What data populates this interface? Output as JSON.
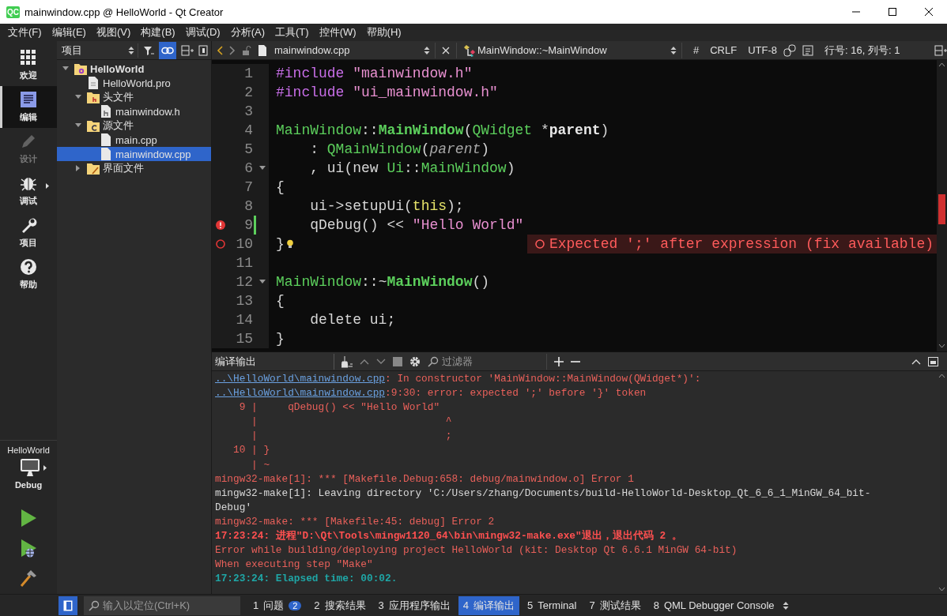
{
  "window": {
    "logo": "QC",
    "title": "mainwindow.cpp @ HelloWorld - Qt Creator"
  },
  "menu": [
    "文件(F)",
    "编辑(E)",
    "视图(V)",
    "构建(B)",
    "调试(D)",
    "分析(A)",
    "工具(T)",
    "控件(W)",
    "帮助(H)"
  ],
  "mode_bar": {
    "items": [
      {
        "kind": "welcome",
        "label": "欢迎",
        "selected": false,
        "disabled": false
      },
      {
        "kind": "edit",
        "label": "编辑",
        "selected": true,
        "disabled": false
      },
      {
        "kind": "design",
        "label": "设计",
        "selected": false,
        "disabled": true
      },
      {
        "kind": "debug",
        "label": "调试",
        "selected": false,
        "disabled": false
      },
      {
        "kind": "projects",
        "label": "项目",
        "selected": false,
        "disabled": false
      },
      {
        "kind": "help",
        "label": "帮助",
        "selected": false,
        "disabled": false
      }
    ],
    "kit": {
      "project": "HelloWorld",
      "config": "Debug"
    }
  },
  "project_panel": {
    "view": "项目",
    "tree": [
      {
        "kind": "project",
        "label": "HelloWorld",
        "expanded": true,
        "selected": false,
        "children": [
          {
            "kind": "pro-file",
            "label": "HelloWorld.pro",
            "selected": false
          },
          {
            "kind": "header-folder",
            "label": "头文件",
            "expanded": true,
            "selected": false,
            "children": [
              {
                "kind": "header-file",
                "label": "mainwindow.h",
                "selected": false
              }
            ]
          },
          {
            "kind": "source-folder",
            "label": "源文件",
            "expanded": true,
            "selected": false,
            "children": [
              {
                "kind": "source-file",
                "label": "main.cpp",
                "selected": false
              },
              {
                "kind": "source-file",
                "label": "mainwindow.cpp",
                "selected": true
              }
            ]
          },
          {
            "kind": "forms-folder",
            "label": "界面文件",
            "expanded": false,
            "selected": false
          }
        ]
      }
    ]
  },
  "editor_toolbar": {
    "file": "mainwindow.cpp",
    "symbol": "MainWindow::~MainWindow",
    "hash": "#",
    "line_ending": "CRLF",
    "encoding": "UTF-8",
    "position": "行号: 16, 列号: 1"
  },
  "editor": {
    "lines": [
      {
        "number": "1",
        "kind": "plain",
        "fold": false,
        "modified": false,
        "tokens": [
          {
            "kind": "preproc",
            "text": "#include "
          },
          {
            "kind": "string",
            "text": "\"mainwindow.h\""
          }
        ]
      },
      {
        "number": "2",
        "kind": "plain",
        "fold": false,
        "modified": false,
        "tokens": [
          {
            "kind": "preproc",
            "text": "#include "
          },
          {
            "kind": "string",
            "text": "\"ui_mainwindow.h\""
          }
        ]
      },
      {
        "number": "3",
        "kind": "plain",
        "fold": false,
        "modified": false
      },
      {
        "number": "4",
        "kind": "plain",
        "fold": false,
        "modified": false,
        "tokens": [
          {
            "kind": "type",
            "text": "MainWindow"
          },
          {
            "kind": "plain",
            "text": "::"
          },
          {
            "kind": "function",
            "text": "MainWindow"
          },
          {
            "kind": "plain",
            "text": "("
          },
          {
            "kind": "type",
            "text": "QWidget"
          },
          {
            "kind": "plain",
            "text": " *"
          },
          {
            "kind": "param",
            "text": "parent"
          },
          {
            "kind": "plain",
            "text": ")"
          }
        ]
      },
      {
        "number": "5",
        "kind": "plain",
        "fold": false,
        "modified": false,
        "tokens": [
          {
            "kind": "plain",
            "text": "    : "
          },
          {
            "kind": "type",
            "text": "QMainWindow"
          },
          {
            "kind": "plain",
            "text": "("
          },
          {
            "kind": "param-use",
            "text": "parent"
          },
          {
            "kind": "plain",
            "text": ")"
          }
        ]
      },
      {
        "number": "6",
        "kind": "plain",
        "fold": true,
        "modified": false,
        "tokens": [
          {
            "kind": "plain",
            "text": "    , ui(new "
          },
          {
            "kind": "type",
            "text": "Ui"
          },
          {
            "kind": "plain",
            "text": "::"
          },
          {
            "kind": "type",
            "text": "MainWindow"
          },
          {
            "kind": "plain",
            "text": ")"
          }
        ]
      },
      {
        "number": "7",
        "kind": "plain",
        "fold": false,
        "modified": false,
        "tokens": [
          {
            "kind": "plain",
            "text": "{"
          }
        ]
      },
      {
        "number": "8",
        "kind": "plain",
        "fold": false,
        "modified": false,
        "tokens": [
          {
            "kind": "plain",
            "text": "    ui->setupUi("
          },
          {
            "kind": "keyword",
            "text": "this"
          },
          {
            "kind": "plain",
            "text": ");"
          }
        ]
      },
      {
        "number": "9",
        "kind": "error",
        "fold": false,
        "modified": true,
        "tokens": [
          {
            "kind": "plain",
            "text": "    qDebug() << "
          },
          {
            "kind": "string",
            "text": "\"Hello World\""
          }
        ]
      },
      {
        "number": "10",
        "kind": "error-ring",
        "fold": false,
        "modified": false,
        "quick_fix": true,
        "annotation": "Expected ';' after expression (fix available)",
        "tokens": [
          {
            "kind": "plain",
            "text": "}"
          }
        ]
      },
      {
        "number": "11",
        "kind": "plain",
        "fold": false,
        "modified": false
      },
      {
        "number": "12",
        "kind": "plain",
        "fold": true,
        "modified": false,
        "tokens": [
          {
            "kind": "type",
            "text": "MainWindow"
          },
          {
            "kind": "plain",
            "text": "::~"
          },
          {
            "kind": "function",
            "text": "MainWindow"
          },
          {
            "kind": "plain",
            "text": "()"
          }
        ]
      },
      {
        "number": "13",
        "kind": "plain",
        "fold": false,
        "modified": false,
        "tokens": [
          {
            "kind": "plain",
            "text": "{"
          }
        ]
      },
      {
        "number": "14",
        "kind": "plain",
        "fold": false,
        "modified": false,
        "tokens": [
          {
            "kind": "plain",
            "text": "    delete ui;"
          }
        ]
      },
      {
        "number": "15",
        "kind": "plain",
        "fold": false,
        "modified": false,
        "tokens": [
          {
            "kind": "plain",
            "text": "}"
          }
        ]
      }
    ]
  },
  "output": {
    "title": "编译输出",
    "filter_placeholder": "过滤器",
    "lines": [
      {
        "kind": "error",
        "link": "..\\HelloWorld\\mainwindow.cpp",
        "text": ": In constructor 'MainWindow::MainWindow(QWidget*)':"
      },
      {
        "kind": "error",
        "link": "..\\HelloWorld\\mainwindow.cpp",
        "text": ":9:30: error: expected ';' before '}' token"
      },
      {
        "kind": "error",
        "text": "    9 |     qDebug() << \"Hello World\""
      },
      {
        "kind": "error",
        "text": "      |                               ^"
      },
      {
        "kind": "error",
        "text": "      |                               ;"
      },
      {
        "kind": "error",
        "text": "   10 | }"
      },
      {
        "kind": "error",
        "text": "      | ~"
      },
      {
        "kind": "error",
        "text": "mingw32-make[1]: *** [Makefile.Debug:658: debug/mainwindow.o] Error 1"
      },
      {
        "kind": "normal",
        "text": "mingw32-make[1]: Leaving directory 'C:/Users/zhang/Documents/build-HelloWorld-Desktop_Qt_6_6_1_MinGW_64_bit-"
      },
      {
        "kind": "normal",
        "text": "Debug'"
      },
      {
        "kind": "error",
        "text": "mingw32-make: *** [Makefile:45: debug] Error 2"
      },
      {
        "kind": "error-bold",
        "text": "17:23:24: 进程\"D:\\Qt\\Tools\\mingw1120_64\\bin\\mingw32-make.exe\"退出，退出代码 2 。"
      },
      {
        "kind": "error",
        "text": "Error while building/deploying project HelloWorld (kit: Desktop Qt 6.6.1 MinGW 64-bit)"
      },
      {
        "kind": "error",
        "text": "When executing step \"Make\""
      },
      {
        "kind": "info",
        "text": "17:23:24: Elapsed time: 00:02."
      }
    ]
  },
  "bottom_bar": {
    "locate_placeholder": "输入以定位(Ctrl+K)",
    "tabs": [
      {
        "number": "1",
        "label": "问题",
        "badge": "2",
        "selected": false
      },
      {
        "number": "2",
        "label": "搜索结果",
        "selected": false
      },
      {
        "number": "3",
        "label": "应用程序输出",
        "selected": false
      },
      {
        "number": "4",
        "label": "编译输出",
        "selected": true
      },
      {
        "number": "5",
        "label": "Terminal",
        "selected": false
      },
      {
        "number": "7",
        "label": "测试结果",
        "selected": false
      },
      {
        "number": "8",
        "label": "QML Debugger Console",
        "selected": false
      }
    ]
  }
}
